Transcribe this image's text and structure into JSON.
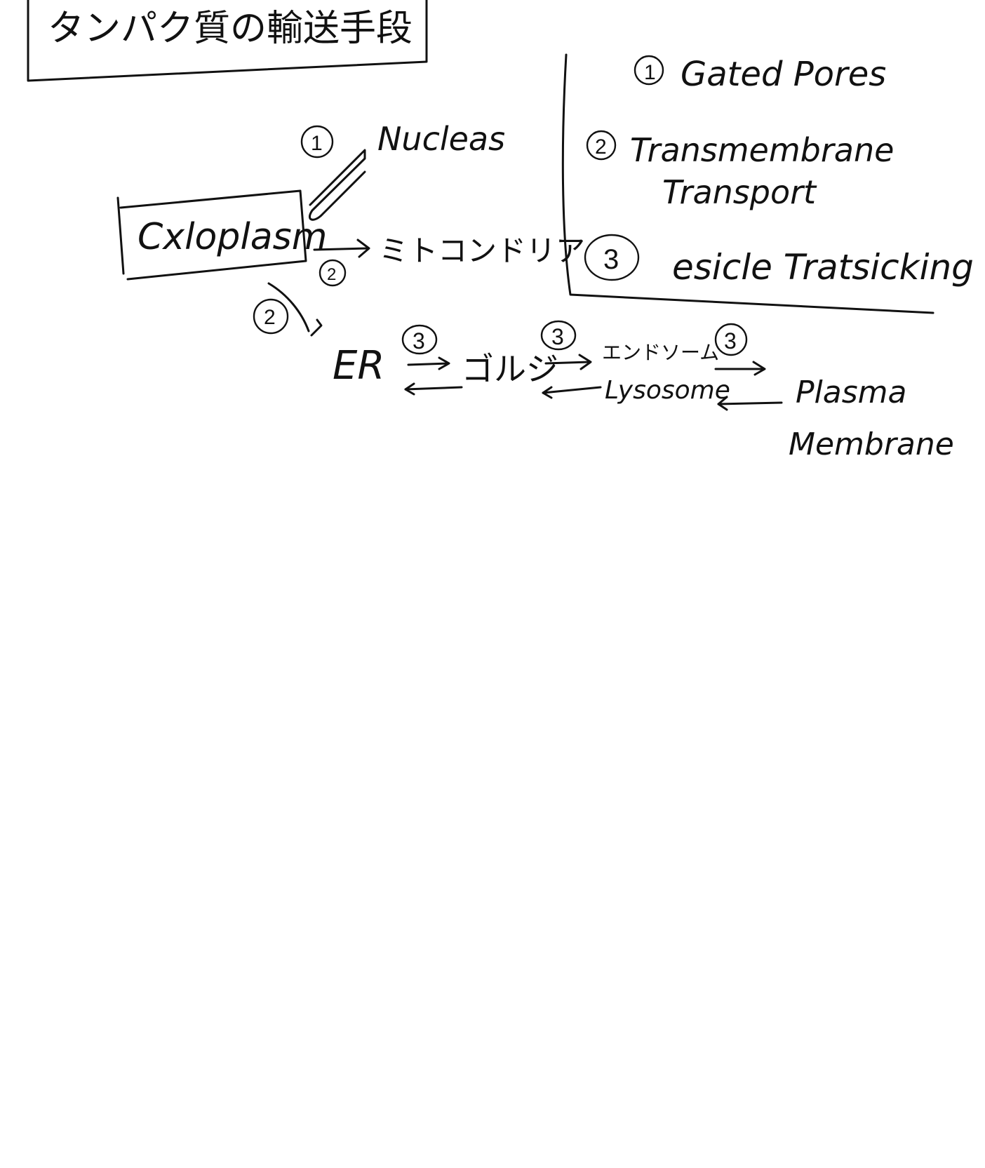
{
  "title": "タンパク質の輸送手段",
  "legend": {
    "items": [
      {
        "num": "1",
        "lines": [
          "Gated Pores"
        ]
      },
      {
        "num": "2",
        "lines": [
          "Transmembrane",
          "Transport"
        ]
      },
      {
        "num": "3",
        "lines": [
          "esicle Tratsicking"
        ]
      }
    ]
  },
  "nodes": {
    "cytoplasm": "Cxloplasm",
    "nucleus": "Nucleas",
    "mitochondria": "ミトコンドリア",
    "er": "ER",
    "golgi": "ゴルジ",
    "endosome": "エンドソーム",
    "lysosome": "Lysosome",
    "plasma_membrane_1": "Plasma",
    "plasma_membrane_2": "Membrane"
  },
  "edge_labels": {
    "to_nucleus": "1",
    "to_mito": "2",
    "to_er": "2",
    "er_golgi": "3",
    "golgi_endosome": "3",
    "endosome_plasma": "3"
  }
}
